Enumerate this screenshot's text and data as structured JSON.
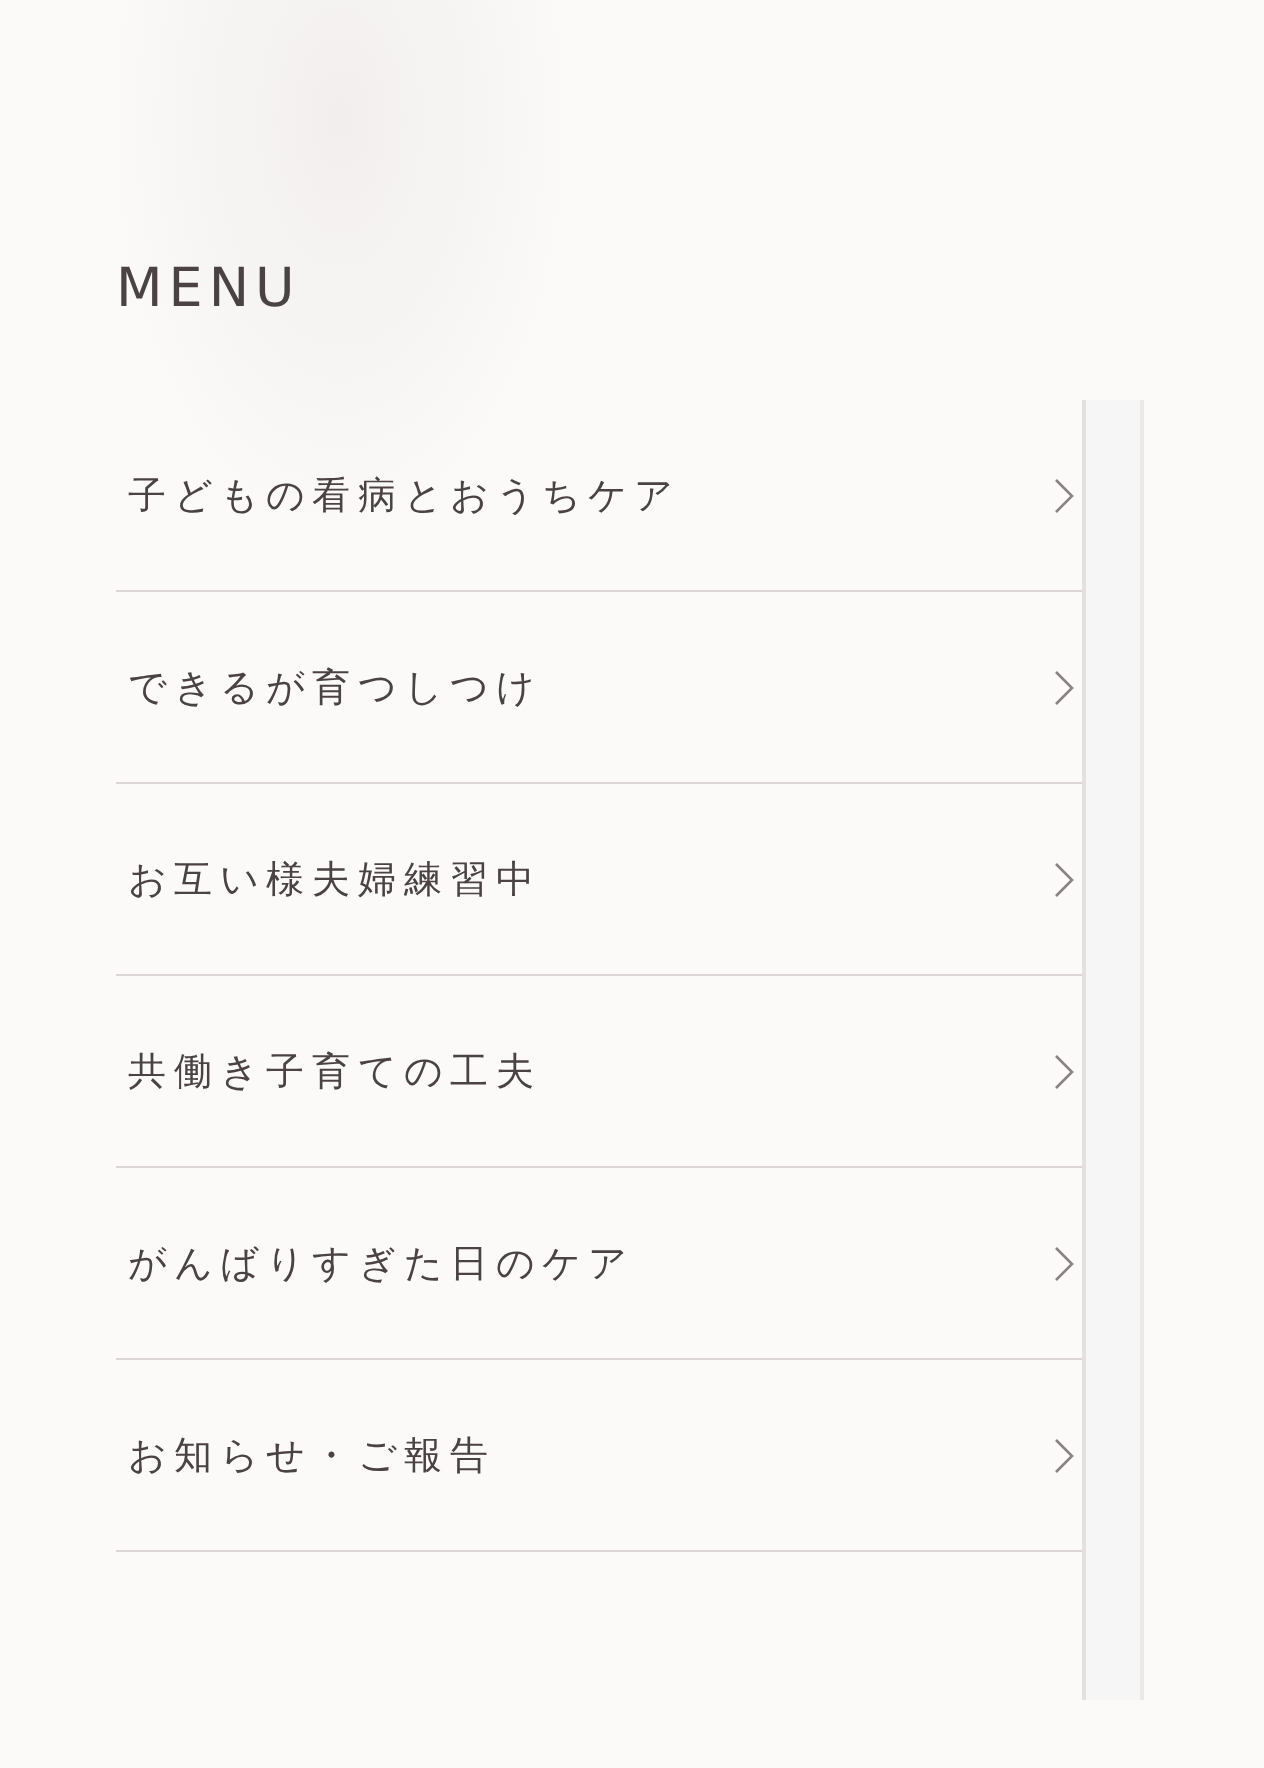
{
  "heading": "MENU",
  "items": [
    {
      "label": "子どもの看病とおうちケア"
    },
    {
      "label": "できるが育つしつけ"
    },
    {
      "label": "お互い様夫婦練習中"
    },
    {
      "label": "共働き子育ての工夫"
    },
    {
      "label": "がんばりすぎた日のケア"
    },
    {
      "label": "お知らせ・ご報告"
    }
  ]
}
